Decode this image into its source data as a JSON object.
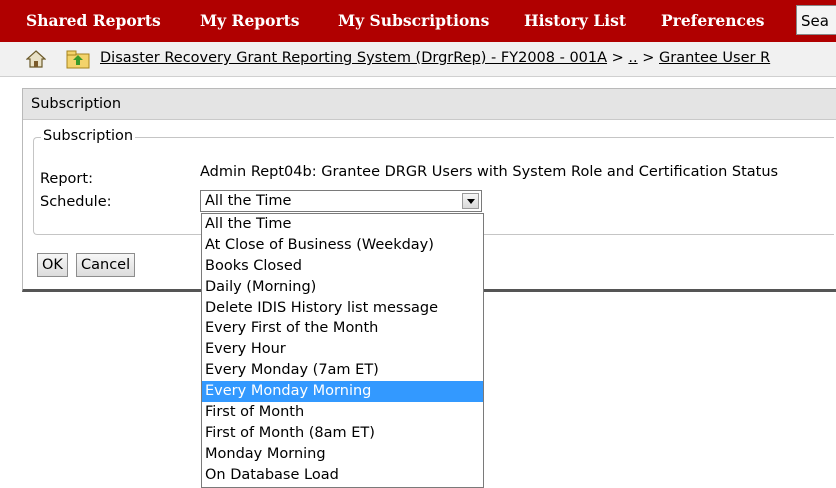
{
  "nav": {
    "items": [
      "Shared Reports",
      "My Reports",
      "My Subscriptions",
      "History List",
      "Preferences"
    ],
    "search_label": "Sea"
  },
  "breadcrumb": {
    "link1": "Disaster Recovery Grant Reporting System (DrgrRep) - FY2008 - 001A",
    "sep1": " > ",
    "dots": "..",
    "sep2": " > ",
    "link2": "Grantee User R"
  },
  "panel": {
    "header": "Subscription",
    "legend": "Subscription",
    "report_label": "Report:",
    "report_value": "Admin Rept04b: Grantee DRGR Users with System Role and Certification Status",
    "schedule_label": "Schedule:",
    "schedule_selected": "All the Time"
  },
  "buttons": {
    "ok": "OK",
    "cancel": "Cancel"
  },
  "schedule_options": [
    "All the Time",
    "At Close of Business (Weekday)",
    "Books Closed",
    "Daily (Morning)",
    "Delete IDIS History list message",
    "Every First of the Month",
    "Every Hour",
    "Every Monday (7am ET)",
    "Every Monday Morning",
    "First of Month",
    "First of Month (8am ET)",
    "Monday Morning",
    "On Database Load"
  ],
  "highlighted_option_index": 8,
  "colors": {
    "nav_bg": "#b00000",
    "highlight": "#3399ff"
  }
}
